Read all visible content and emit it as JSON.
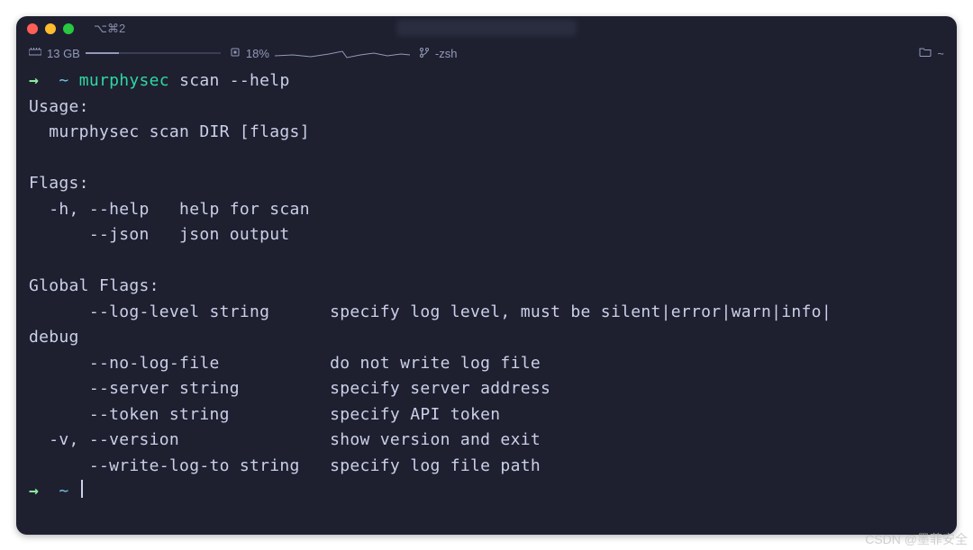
{
  "window": {
    "tab_label": "⌥⌘2"
  },
  "status": {
    "memory_label": "13 GB",
    "cpu_percent": "18%",
    "shell": "-zsh",
    "cwd": "~"
  },
  "prompt1": {
    "arrow": "→",
    "path": "~",
    "cmd": "murphysec",
    "args": "scan --help"
  },
  "output": {
    "usage_header": "Usage:",
    "usage_line": "  murphysec scan DIR [flags]",
    "flags_header": "Flags:",
    "flag_help": "  -h, --help   help for scan",
    "flag_json": "      --json   json output",
    "global_header": "Global Flags:",
    "g_loglevel": "      --log-level string      specify log level, must be silent|error|warn|info|",
    "g_debug": "debug",
    "g_nologfile": "      --no-log-file           do not write log file",
    "g_server": "      --server string         specify server address",
    "g_token": "      --token string          specify API token",
    "g_version": "  -v, --version               show version and exit",
    "g_writelog": "      --write-log-to string   specify log file path"
  },
  "prompt2": {
    "arrow": "→",
    "path": "~"
  },
  "watermark": "CSDN @墨菲安全"
}
